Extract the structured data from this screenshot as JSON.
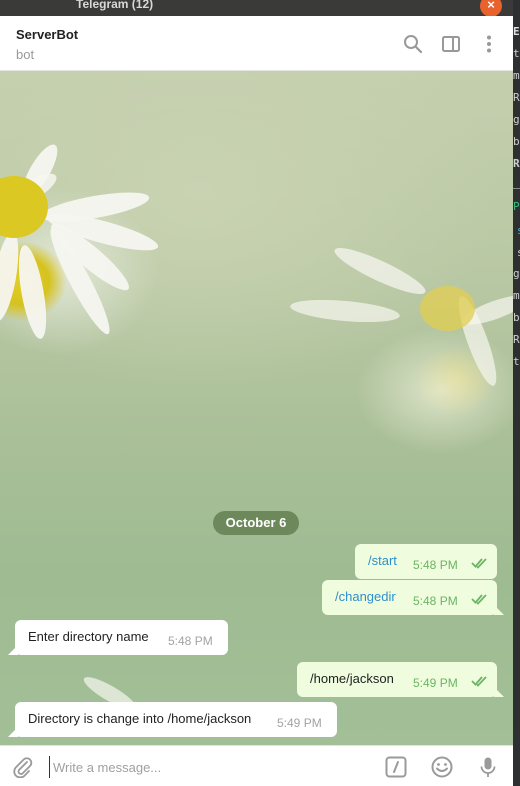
{
  "window": {
    "title": "Telegram (12)",
    "close_glyph": "×"
  },
  "header": {
    "chat_name": "ServerBot",
    "chat_status": "bot",
    "icons": [
      "search-icon",
      "sidebar-toggle-icon",
      "more-vertical-icon"
    ]
  },
  "chat": {
    "date_divider": "October 6",
    "messages": [
      {
        "direction": "out",
        "text": "/start",
        "time": "5:48 PM",
        "read": true,
        "is_command": true
      },
      {
        "direction": "out",
        "text": "/changedir",
        "time": "5:48 PM",
        "read": true,
        "is_command": true
      },
      {
        "direction": "in",
        "text": "Enter directory name",
        "time": "5:48 PM"
      },
      {
        "direction": "out",
        "text": "/home/jackson",
        "time": "5:49 PM",
        "read": true,
        "is_command": false
      },
      {
        "direction": "in",
        "text": "Directory is change into /home/jackson",
        "time": "5:49 PM"
      }
    ]
  },
  "composer": {
    "placeholder": "Write a message...",
    "value": "",
    "icons": [
      "attach-icon",
      "bot-commands-icon",
      "emoji-icon",
      "microphone-icon"
    ]
  },
  "side_strip": {
    "lines": [
      "ED",
      "to",
      "m",
      "RI",
      "g",
      "be",
      "RE",
      "Pi",
      "s",
      "s",
      "g",
      "m",
      "be",
      "RI",
      "to"
    ]
  },
  "colors": {
    "accent_blue": "#2f8fcb",
    "outgoing_bubble": "#effdde",
    "read_ticks": "#6cb465",
    "close_button": "#e7622d",
    "icon_gray": "#999999"
  }
}
